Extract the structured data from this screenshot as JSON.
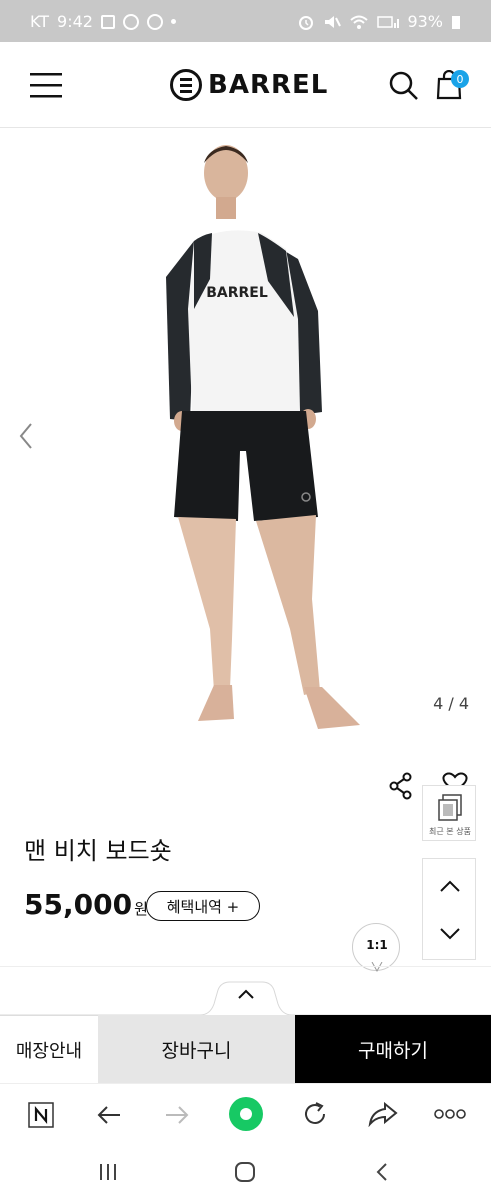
{
  "status_bar": {
    "carrier": "KT",
    "time": "9:42",
    "battery": "93%"
  },
  "header": {
    "brand": "BARREL",
    "cart_count": "0"
  },
  "gallery": {
    "shirt_logo": "BARREL",
    "counter": "4 / 4"
  },
  "product": {
    "name": "맨 비치 보드숏",
    "price": "55,000",
    "currency": "원",
    "benefit_label": "혜택내역 +"
  },
  "floating": {
    "recent_label": "최근 본 상품",
    "chat_label": "1:1"
  },
  "actions": {
    "store_label": "매장안내",
    "cart_label": "장바구니",
    "buy_label": "구매하기"
  },
  "colors": {
    "cart_badge": "#1aa3e8",
    "browser_accent": "#17c964",
    "buy_bg": "#000000"
  }
}
